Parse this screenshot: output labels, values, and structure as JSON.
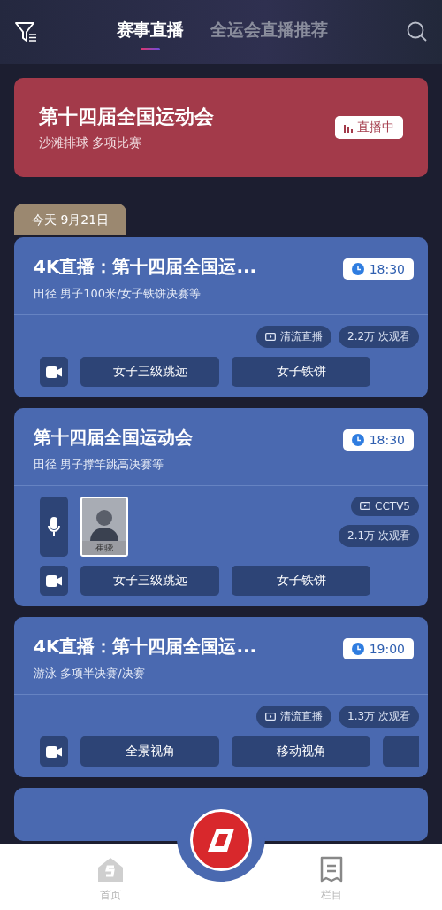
{
  "tabs": [
    {
      "label": "赛事直播",
      "selected": true
    },
    {
      "label": "全运会直播推荐",
      "selected": false
    }
  ],
  "hero": {
    "title": "第十四届全国运动会",
    "subtitle": "沙滩排球 多项比赛",
    "badge": "直播中"
  },
  "date_tab": "今天 9月21日",
  "cards": [
    {
      "title": "4K直播：第十四届全国运...",
      "subtitle": "田径 男子100米/女子铁饼决赛等",
      "time": "18:30",
      "channel": "清流直播",
      "views": "2.2万 次观看",
      "angles": [
        "女子三级跳远",
        "女子铁饼"
      ]
    },
    {
      "title": "第十四届全国运动会",
      "subtitle": "田径 男子撑竿跳高决赛等",
      "time": "18:30",
      "channel": "CCTV5",
      "views": "2.1万 次观看",
      "commentator": {
        "name": "崔骁"
      },
      "angles": [
        "女子三级跳远",
        "女子铁饼"
      ]
    },
    {
      "title": "4K直播：第十四届全国运...",
      "subtitle": "游泳 多项半决赛/决赛",
      "time": "19:00",
      "channel": "清流直播",
      "views": "1.3万 次观看",
      "angles": [
        "全景视角",
        "移动视角"
      ],
      "more_angles": true
    }
  ],
  "bottom_nav": [
    {
      "kind": "home",
      "label": "首页"
    },
    {
      "kind": "column",
      "label": "栏目"
    }
  ]
}
